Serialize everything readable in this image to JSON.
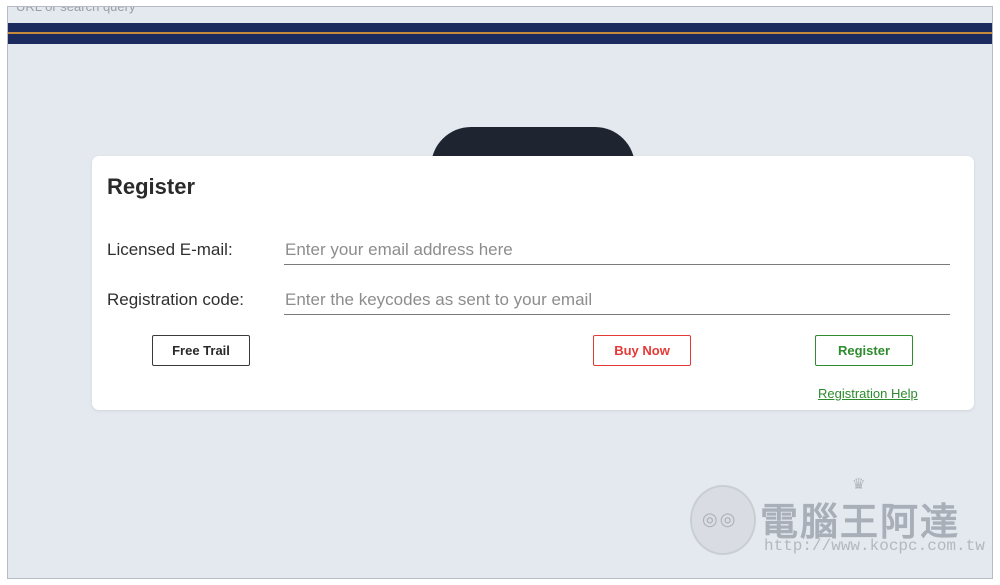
{
  "browser": {
    "address_text": "URL or search query"
  },
  "register_card": {
    "title": "Register",
    "email_label": "Licensed E-mail:",
    "email_placeholder": "Enter your email address here",
    "email_value": "",
    "code_label": "Registration code:",
    "code_placeholder": "Enter the keycodes as sent to your email",
    "code_value": "",
    "free_trial_label": "Free Trail",
    "buy_now_label": "Buy Now",
    "register_label": "Register",
    "help_link_label": "Registration Help"
  },
  "watermark": {
    "title": "電腦王阿達",
    "url": "http://www.kocpc.com.tw",
    "icons": [
      "mascot-face-icon",
      "crown-icon"
    ]
  },
  "colors": {
    "header_navy": "#1c2b5e",
    "header_accent": "#c68a3c",
    "page_background": "#e4e8ef",
    "buy_now_red": "#e53935",
    "register_green": "#2e8b2e"
  }
}
